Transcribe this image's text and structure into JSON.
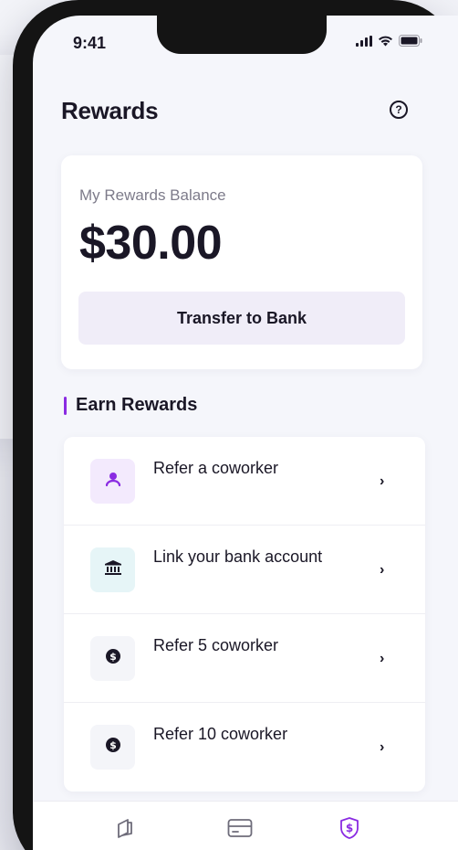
{
  "status_bar": {
    "time": "9:41",
    "icons": [
      "signal-icon",
      "wifi-icon",
      "battery-icon"
    ]
  },
  "header": {
    "title": "Rewards",
    "help_icon": "help-circle-icon",
    "help_glyph": "?"
  },
  "balance": {
    "label": "My Rewards Balance",
    "amount": "$30.00",
    "transfer_label": "Transfer to Bank"
  },
  "earn_section": {
    "title": "Earn Rewards",
    "accent_color": "#8a2be2",
    "items": [
      {
        "label": "Refer a coworker",
        "icon": "person-icon",
        "icon_bg": "#f3eafd",
        "icon_color": "#8a2be2"
      },
      {
        "label": "Link your bank account",
        "icon": "bank-icon",
        "icon_bg": "#e6f5f7",
        "icon_color": "#1a1726"
      },
      {
        "label": "Refer 5 coworker",
        "icon": "dollar-coin-icon",
        "icon_bg": "#f4f5f9",
        "icon_color": "#1a1726"
      },
      {
        "label": "Refer 10 coworker",
        "icon": "dollar-coin-icon",
        "icon_bg": "#f4f5f9",
        "icon_color": "#1a1726"
      }
    ],
    "chevron": "›"
  },
  "tab_bar": {
    "tabs": [
      {
        "icon": "wallet-card-icon",
        "active": false
      },
      {
        "icon": "credit-card-icon",
        "active": false
      },
      {
        "icon": "rewards-shield-dollar-icon",
        "active": true
      }
    ],
    "active_color": "#8a2be2",
    "inactive_color": "#6e6c7a"
  }
}
